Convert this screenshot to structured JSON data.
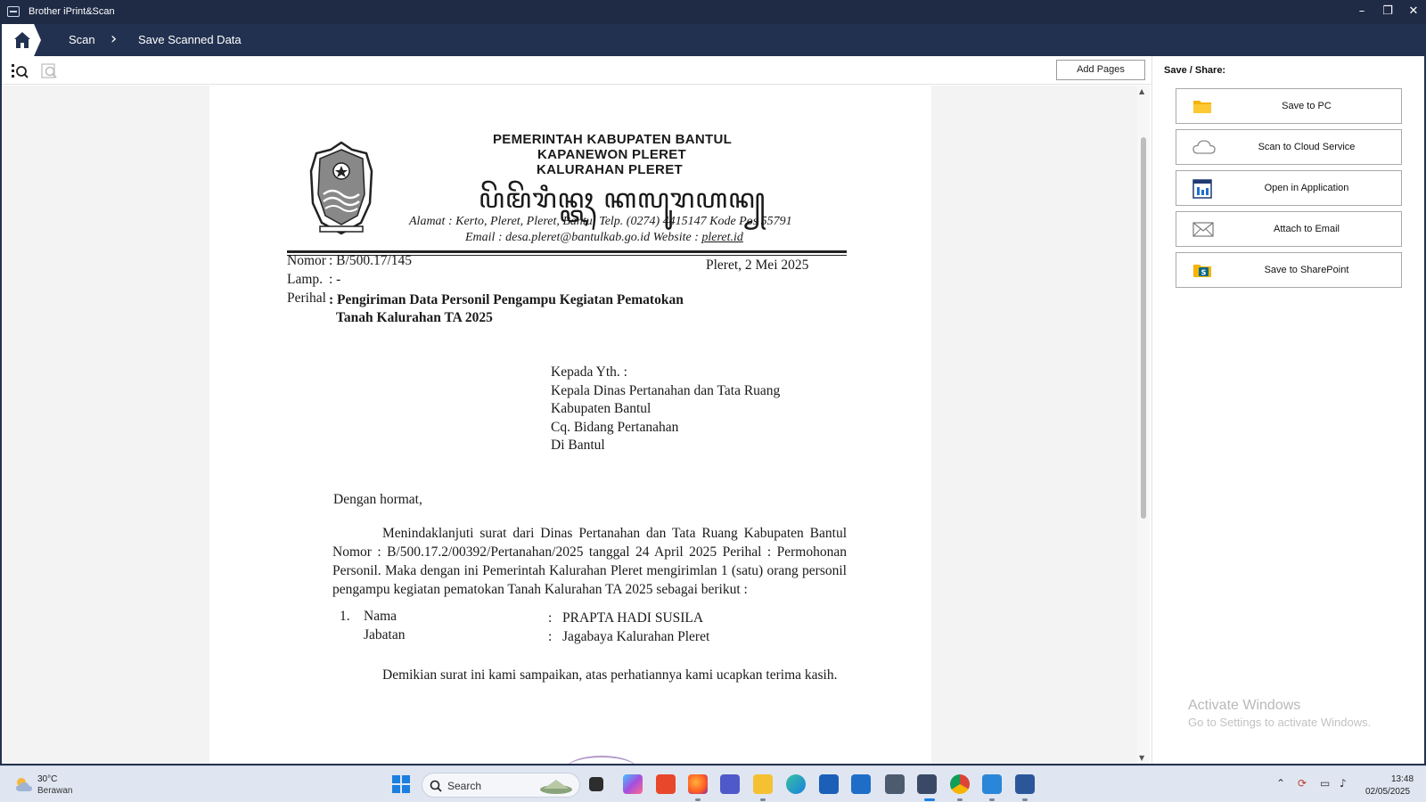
{
  "window": {
    "title": "Brother iPrint&Scan",
    "minimize": "–",
    "maximize": "❐",
    "close": "✕"
  },
  "nav": {
    "crumb1": "Scan",
    "separator": "›",
    "crumb2": "Save Scanned Data"
  },
  "toolbar": {
    "add_pages": "Add Pages"
  },
  "share_panel": {
    "title": "Save / Share:",
    "buttons": [
      {
        "label": "Save to PC",
        "icon": "folder-icon"
      },
      {
        "label": "Scan to Cloud Service",
        "icon": "cloud-icon"
      },
      {
        "label": "Open in Application",
        "icon": "application-icon"
      },
      {
        "label": "Attach to Email",
        "icon": "envelope-icon"
      },
      {
        "label": "Save to SharePoint",
        "icon": "sharepoint-icon"
      }
    ]
  },
  "document": {
    "header": {
      "line1": "PEMERINTAH KABUPATEN BANTUL",
      "line2": "KAPANEWON PLERET",
      "line3": "KALURAHAN PLERET",
      "javanese": "ꦥꦼꦩꦼꦫꦶꦤ꧀ꦠꦃ ꦏꦭꦸꦫꦲꦤ꧀",
      "address": "Alamat : Kerto, Pleret, Pleret, Bantul Telp. (0274) 4415147  Kode Pos 55791",
      "email_prefix": "Email : desa.pleret@bantulkab.go.id Website : ",
      "website": "pleret.id"
    },
    "meta": {
      "nomor_label": "Nomor",
      "nomor_value": ": B/500.17/145",
      "date": "Pleret,  2 Mei  2025",
      "lamp_label": "Lamp.",
      "lamp_value": ": -",
      "perihal_label": "Perihal",
      "perihal_value1": ": Pengiriman Data Personil Pengampu Kegiatan Pematokan",
      "perihal_value2": "Tanah Kalurahan TA 2025"
    },
    "recipient": [
      "Kepada Yth. :",
      "Kepala Dinas Pertanahan dan Tata Ruang",
      "Kabupaten Bantul",
      "Cq. Bidang Pertanahan",
      "Di Bantul"
    ],
    "greeting": "Dengan hormat,",
    "body": "Menindaklanjuti surat dari Dinas Pertanahan dan Tata Ruang Kabupaten Bantul Nomor : B/500.17.2/00392/Pertanahan/2025 tanggal 24 April 2025 Perihal : Permohonan Personil. Maka dengan ini Pemerintah Kalurahan Pleret mengirimlan 1 (satu) orang personil pengampu kegiatan pematokan Tanah Kalurahan TA 2025 sebagai berikut :",
    "list": {
      "number": "1.",
      "nama_label": "Nama",
      "nama_value": "PRAPTA HADI SUSILA",
      "jabatan_label": "Jabatan",
      "jabatan_value": "Jagabaya Kalurahan Pleret",
      "colon": ":"
    },
    "closing": "Demikian surat ini kami sampaikan, atas perhatiannya kami ucapkan terima kasih."
  },
  "activation": {
    "line1": "Activate Windows",
    "line2": "Go to Settings to activate Windows."
  },
  "taskbar": {
    "weather_temp": "30°C",
    "weather_desc": "Berawan",
    "search_placeholder": "Search",
    "time": "13:48",
    "date": "02/05/2025"
  }
}
